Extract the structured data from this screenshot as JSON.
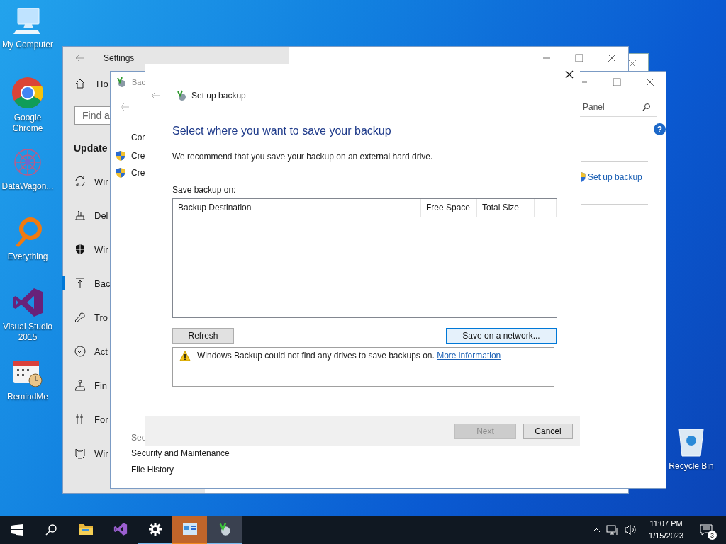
{
  "desktop_icons": [
    {
      "label": "My Computer",
      "kind": "computer"
    },
    {
      "label": "Google Chrome",
      "kind": "chrome"
    },
    {
      "label": "DataWagon...",
      "kind": "datawagon"
    },
    {
      "label": "Everything",
      "kind": "everything"
    },
    {
      "label": "Visual Studio 2015",
      "kind": "vs"
    },
    {
      "label": "RemindMe",
      "kind": "calendar"
    }
  ],
  "recycle_bin": {
    "label": "Recycle Bin"
  },
  "settings_window": {
    "title": "Settings",
    "home": "Ho",
    "search": {
      "placeholder": "Find a"
    },
    "section": "Update",
    "nav": [
      {
        "label": "Wir",
        "kind": "sync",
        "selected": false
      },
      {
        "label": "Del",
        "kind": "delivery",
        "selected": false
      },
      {
        "label": "Wir",
        "kind": "shield",
        "selected": false
      },
      {
        "label": "Bac",
        "kind": "backup",
        "selected": true
      },
      {
        "label": "Tro",
        "kind": "wrench",
        "selected": false
      },
      {
        "label": "Act",
        "kind": "check",
        "selected": false
      },
      {
        "label": "Fin",
        "kind": "find",
        "selected": false
      },
      {
        "label": "For",
        "kind": "dev",
        "selected": false
      },
      {
        "label": "Wir",
        "kind": "insider",
        "selected": false
      }
    ]
  },
  "control_panel": {
    "title": "Bac",
    "search": {
      "placeholder": "Panel"
    },
    "help": "?",
    "heading": "Cor",
    "tasks": [
      "Cre",
      "Cre"
    ],
    "link": "Set up backup",
    "see_also": "See",
    "see_links": [
      "Security and Maintenance",
      "File History"
    ]
  },
  "dialog": {
    "title": "Set up backup",
    "heading": "Select where you want to save your backup",
    "intro": "We recommend that you save your backup on an external hard drive.",
    "list_label": "Save backup on:",
    "columns": [
      "Backup Destination",
      "Free Space",
      "Total Size"
    ],
    "list_buttons": [
      {
        "label": "Refresh",
        "hovered": false
      },
      {
        "label": "Save on a network...",
        "hovered": true
      }
    ],
    "message": {
      "text": "Windows Backup could not find any drives to save backups on.",
      "link": "More information"
    },
    "buttons": [
      {
        "label": "Next",
        "disabled": true
      },
      {
        "label": "Cancel",
        "disabled": false
      }
    ]
  },
  "taskbar": {
    "apps": [
      {
        "kind": "explorer",
        "running": false,
        "selected": false,
        "attention": false
      },
      {
        "kind": "vs",
        "running": false,
        "selected": false,
        "attention": false
      },
      {
        "kind": "settings",
        "running": true,
        "selected": false,
        "attention": false
      },
      {
        "kind": "controlpanel",
        "running": true,
        "selected": false,
        "attention": true
      },
      {
        "kind": "backup",
        "running": true,
        "selected": true,
        "attention": false
      }
    ],
    "clock": {
      "time": "11:07 PM",
      "date": "1/15/2023"
    },
    "notifications": "3"
  }
}
